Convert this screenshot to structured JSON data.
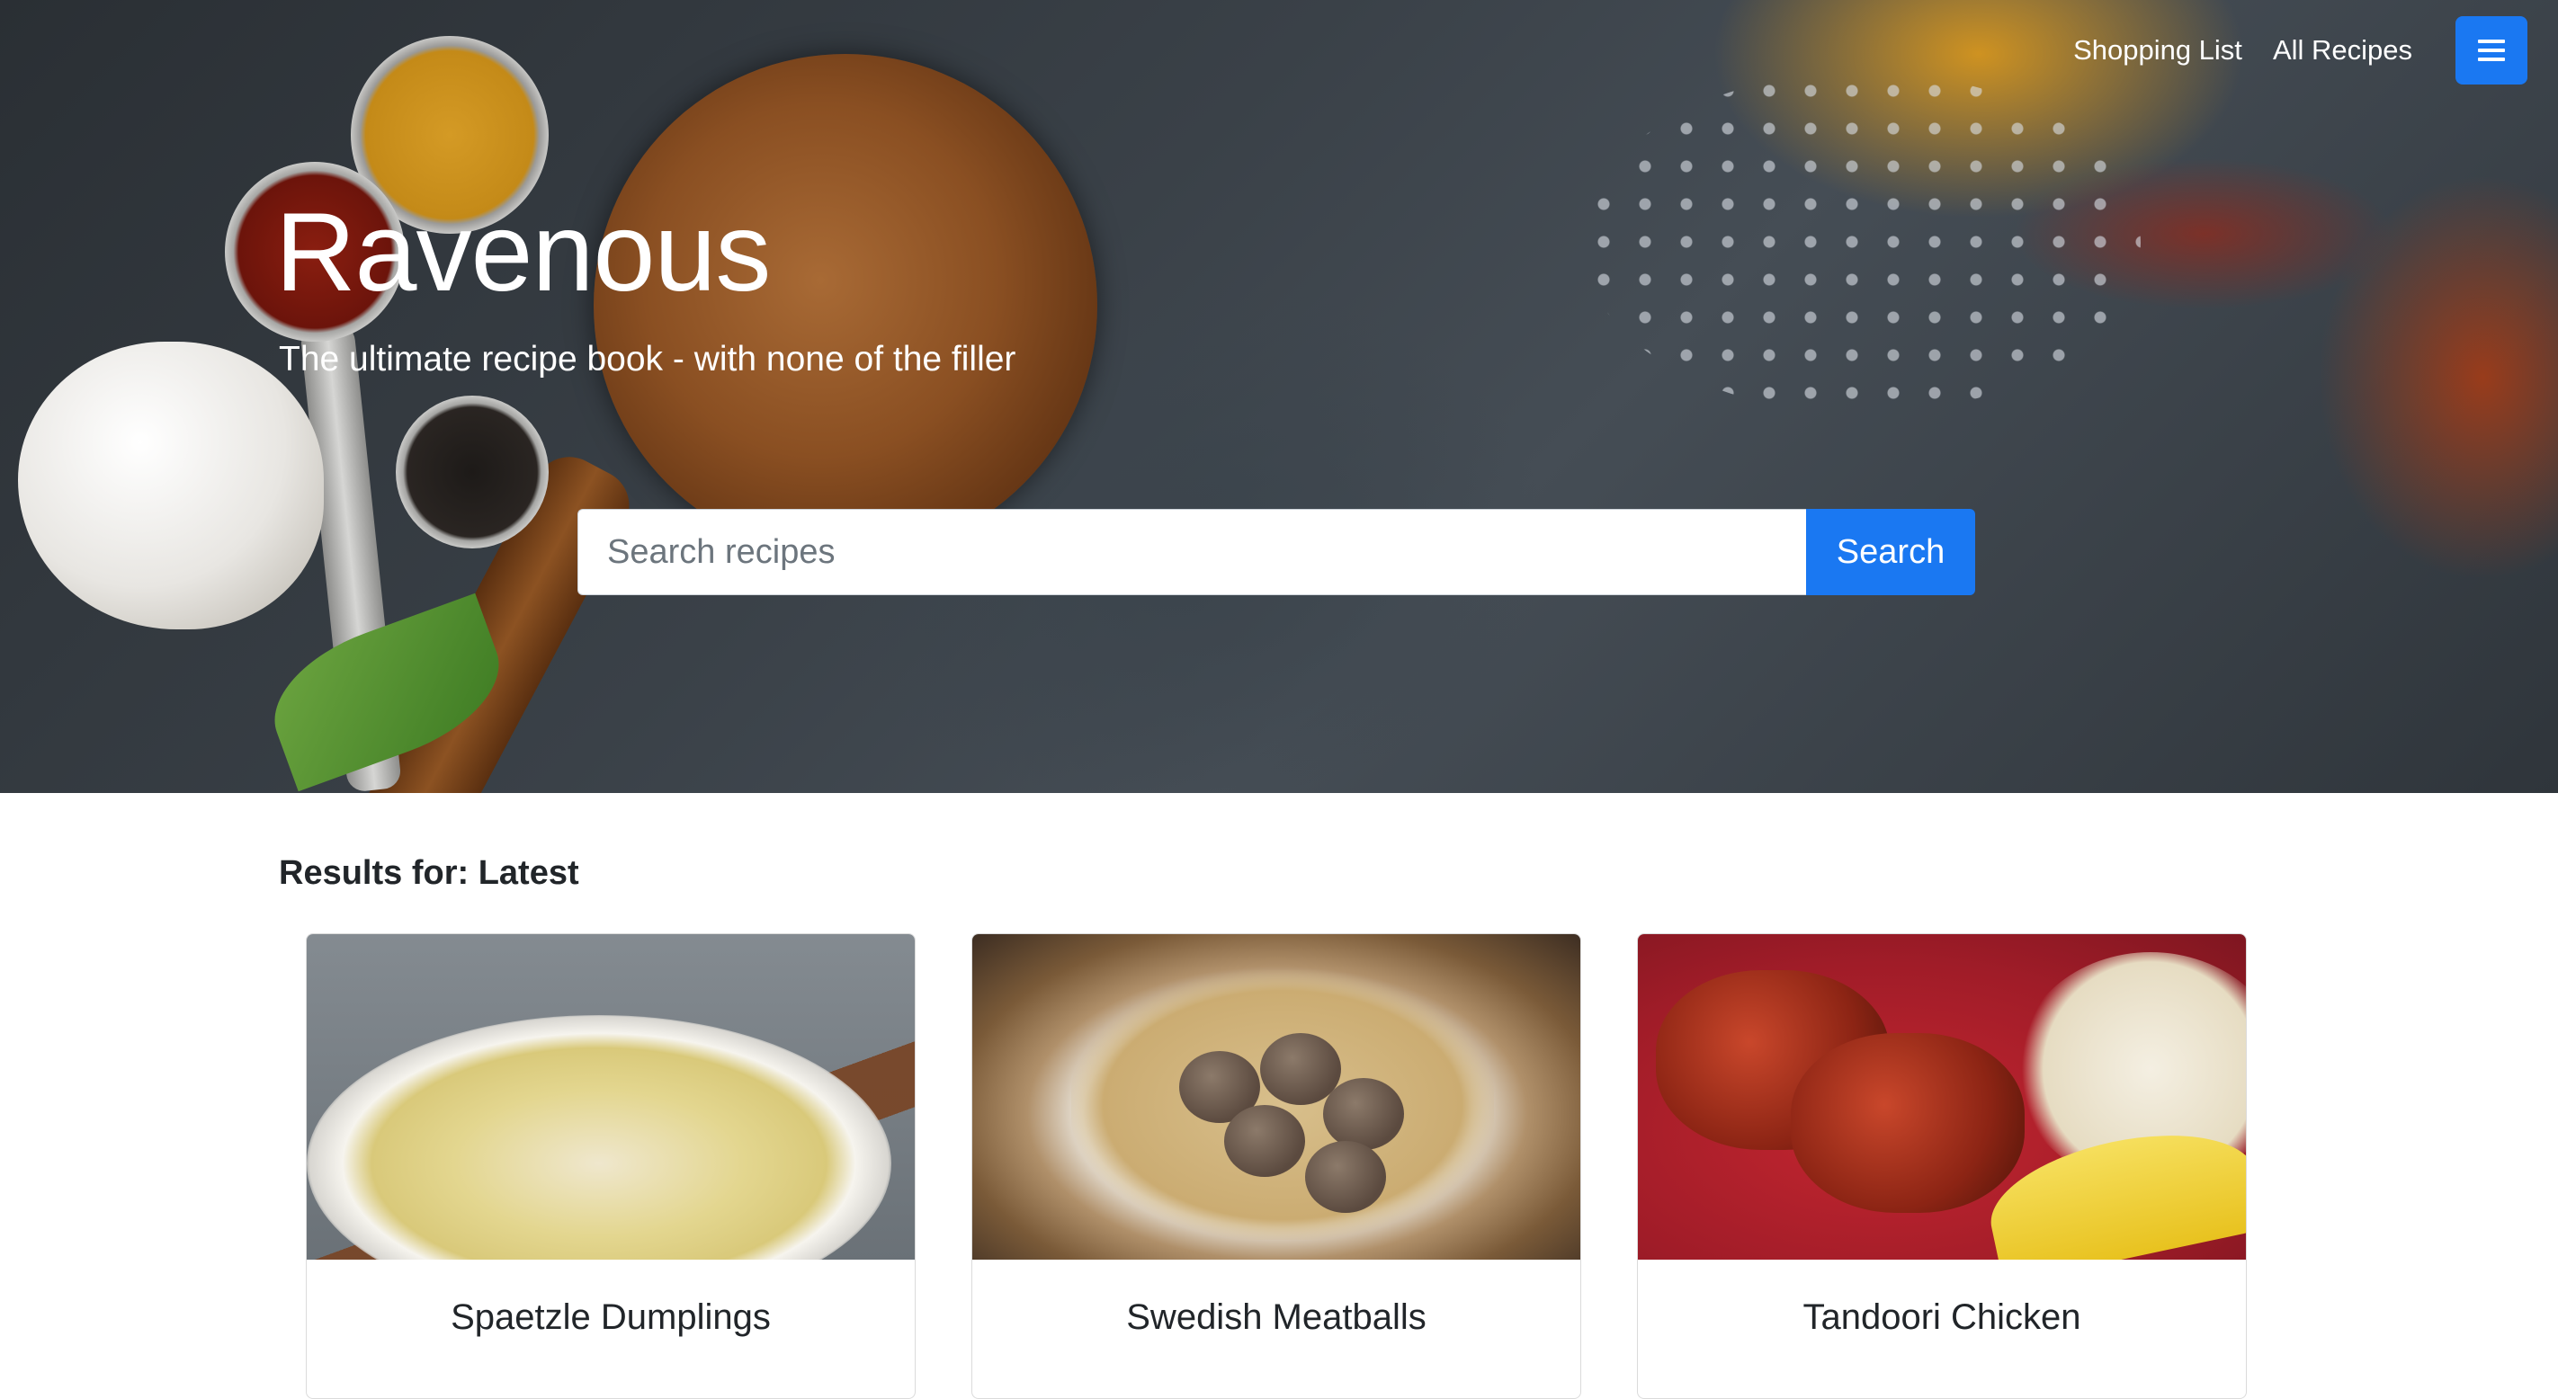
{
  "nav": {
    "shopping_list": "Shopping List",
    "all_recipes": "All Recipes",
    "menu_icon": "hamburger-menu-icon"
  },
  "hero": {
    "title": "Ravenous",
    "tagline": "The ultimate recipe book - with none of the filler"
  },
  "search": {
    "placeholder": "Search recipes",
    "value": "",
    "button_label": "Search"
  },
  "results": {
    "heading": "Results for: Latest",
    "cards": [
      {
        "title": "Spaetzle Dumplings"
      },
      {
        "title": "Swedish Meatballs"
      },
      {
        "title": "Tandoori Chicken"
      }
    ]
  },
  "colors": {
    "accent": "#1a78f2",
    "hero_text": "#ffffff",
    "body_text": "#212529"
  }
}
